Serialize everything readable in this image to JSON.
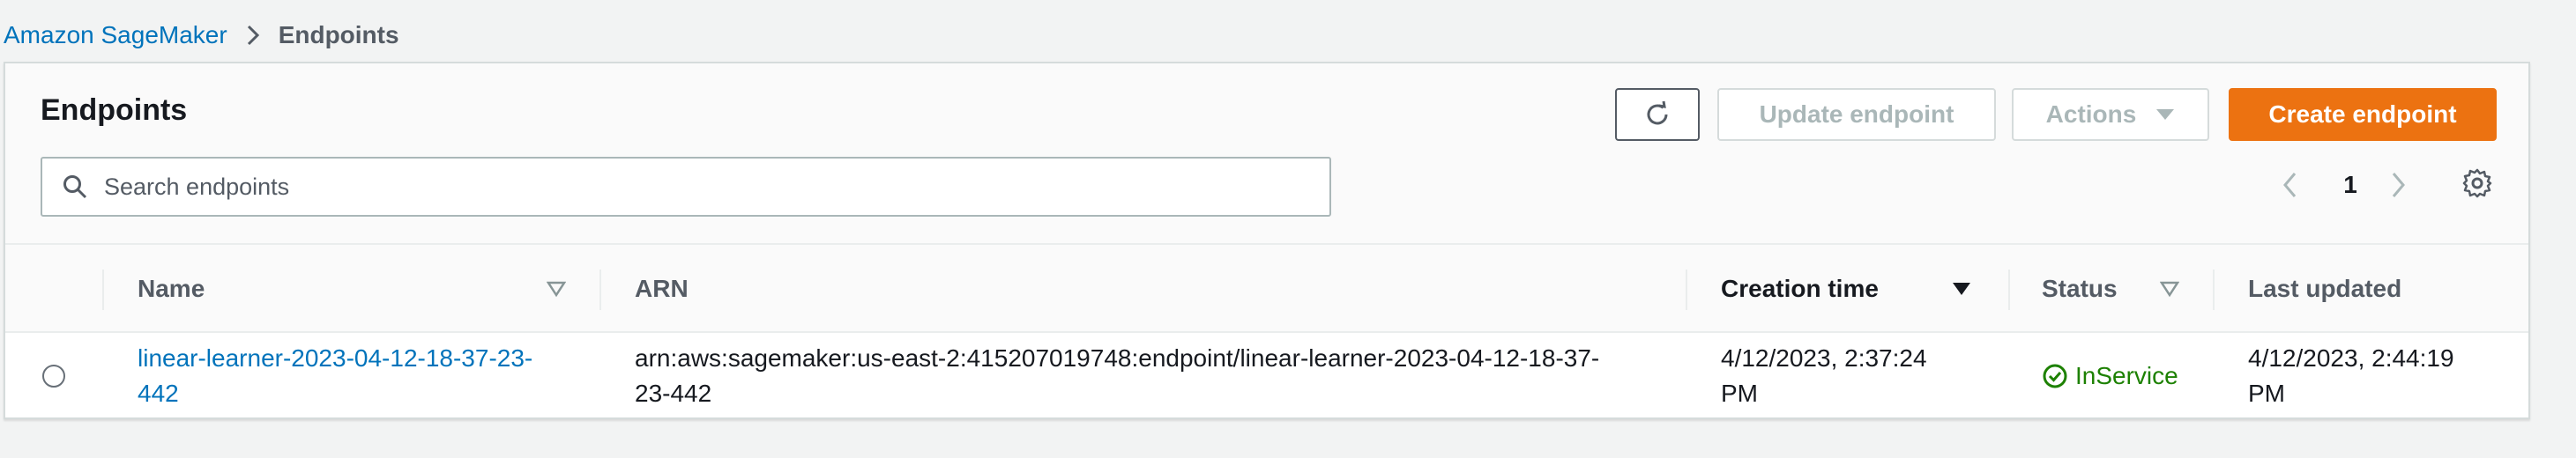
{
  "breadcrumb": {
    "home": "Amazon SageMaker",
    "current": "Endpoints"
  },
  "panel": {
    "title": "Endpoints"
  },
  "toolbar": {
    "refresh_icon": "refresh-icon",
    "update_label": "Update endpoint",
    "actions_label": "Actions",
    "create_label": "Create endpoint"
  },
  "search": {
    "placeholder": "Search endpoints"
  },
  "pagination": {
    "current_page": "1"
  },
  "table": {
    "columns": {
      "name": "Name",
      "arn": "ARN",
      "creation_time": "Creation time",
      "status": "Status",
      "last_updated": "Last updated"
    },
    "rows": [
      {
        "name_line1": "linear-learner-2023-04-12-18-37-23-",
        "name_line2": "442",
        "arn_line1": "arn:aws:sagemaker:us-east-2:415207019748:endpoint/linear-learner-2023-04-12-18-37-",
        "arn_line2": "23-442",
        "creation_line1": "4/12/2023, 2:37:24",
        "creation_line2": "PM",
        "status": "InService",
        "updated_line1": "4/12/2023, 2:44:19",
        "updated_line2": "PM"
      }
    ]
  },
  "colors": {
    "link": "#0073bb",
    "primary_button": "#ec7211",
    "success": "#1d8102"
  }
}
